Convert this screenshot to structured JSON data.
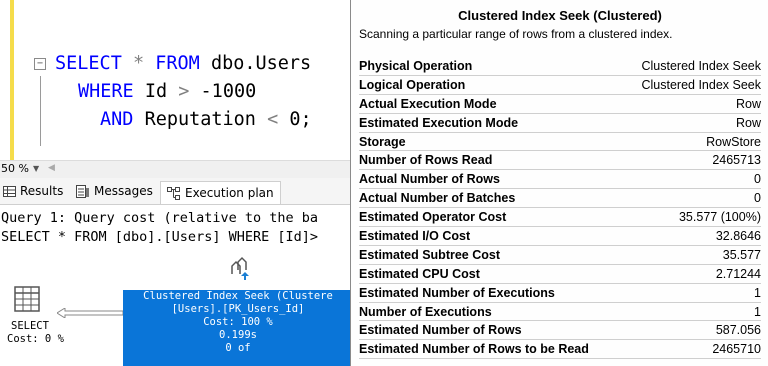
{
  "editor": {
    "line1": {
      "kw1": "SELECT",
      "star": "*",
      "kw2": "FROM",
      "obj": "dbo.Users"
    },
    "line2": {
      "kw": "WHERE",
      "col": "Id",
      "op": ">",
      "val": "-1000"
    },
    "line3": {
      "kw": "AND",
      "col": "Reputation",
      "op": "<",
      "val": "0;"
    }
  },
  "zoom": {
    "value": "50 %"
  },
  "tabs": [
    {
      "label": "Results",
      "icon": "grid-icon"
    },
    {
      "label": "Messages",
      "icon": "messages-icon"
    },
    {
      "label": "Execution plan",
      "icon": "execution-plan-icon",
      "active": true
    }
  ],
  "results": {
    "line1": "Query 1: Query cost (relative to the ba",
    "line2": "SELECT * FROM [dbo].[Users] WHERE [Id]>"
  },
  "plan": {
    "select": {
      "label": "SELECT",
      "cost": "Cost: 0 %"
    },
    "seek": {
      "line1": "Clustered Index Seek (Clustere",
      "line2": "[Users].[PK_Users_Id]",
      "line3": "Cost: 100 %",
      "line4": "0.199s",
      "line5": "0 of"
    }
  },
  "tooltip": {
    "title": "Clustered Index Seek (Clustered)",
    "description": "Scanning a particular range of rows from a clustered index.",
    "rows": [
      {
        "key": "Physical Operation",
        "value": "Clustered Index Seek"
      },
      {
        "key": "Logical Operation",
        "value": "Clustered Index Seek"
      },
      {
        "key": "Actual Execution Mode",
        "value": "Row"
      },
      {
        "key": "Estimated Execution Mode",
        "value": "Row"
      },
      {
        "key": "Storage",
        "value": "RowStore"
      },
      {
        "key": "Number of Rows Read",
        "value": "2465713"
      },
      {
        "key": "Actual Number of Rows",
        "value": "0"
      },
      {
        "key": "Actual Number of Batches",
        "value": "0"
      },
      {
        "key": "Estimated Operator Cost",
        "value": "35.577 (100%)"
      },
      {
        "key": "Estimated I/O Cost",
        "value": "32.8646"
      },
      {
        "key": "Estimated Subtree Cost",
        "value": "35.577"
      },
      {
        "key": "Estimated CPU Cost",
        "value": "2.71244"
      },
      {
        "key": "Estimated Number of Executions",
        "value": "1"
      },
      {
        "key": "Number of Executions",
        "value": "1"
      },
      {
        "key": "Estimated Number of Rows",
        "value": "587.056"
      },
      {
        "key": "Estimated Number of Rows to be Read",
        "value": "2465710"
      }
    ]
  }
}
